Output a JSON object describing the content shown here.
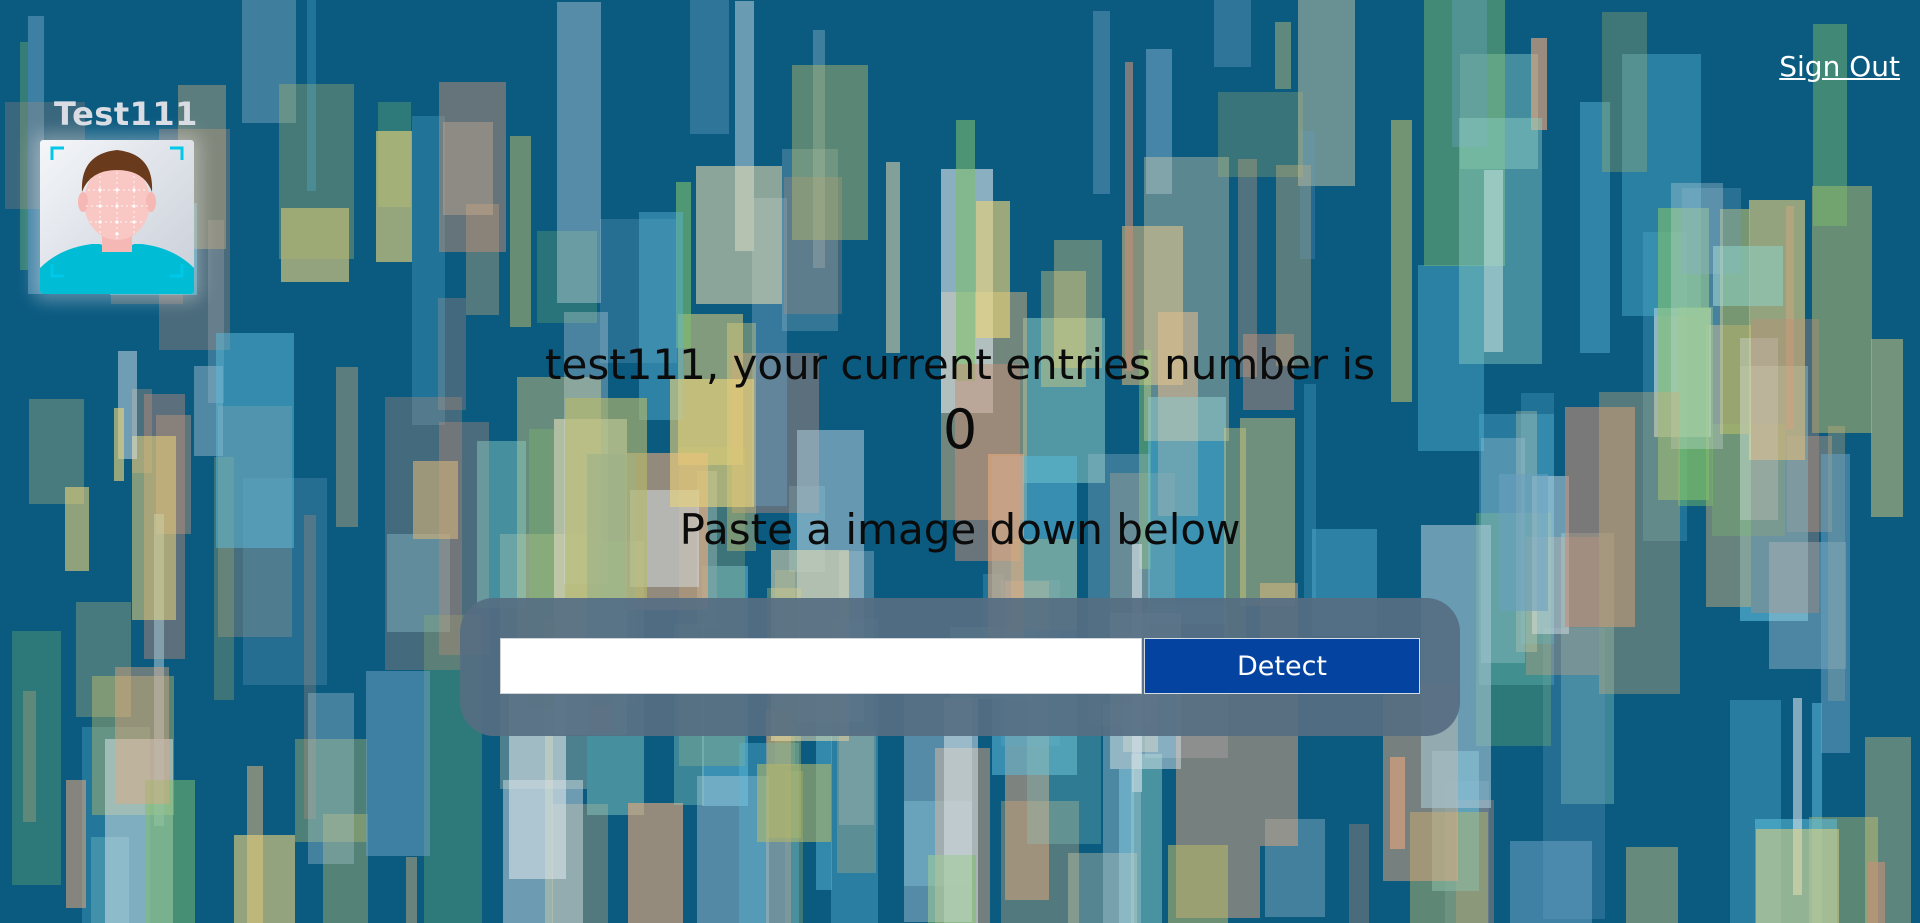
{
  "nav": {
    "signout_label": "Sign Out"
  },
  "logo": {
    "username": "Test111",
    "icon": "face-detection-avatar-icon"
  },
  "rank": {
    "message": "test111, your current entries number is",
    "count": "0"
  },
  "form": {
    "prompt": "Paste a image down below",
    "input_value": "",
    "input_placeholder": "",
    "detect_label": "Detect"
  },
  "colors": {
    "background": "#0b5a80",
    "button": "#0443a0",
    "panel": "#566e82",
    "text": "#0b0b0b",
    "avatar_shirt": "#00bcd4"
  }
}
